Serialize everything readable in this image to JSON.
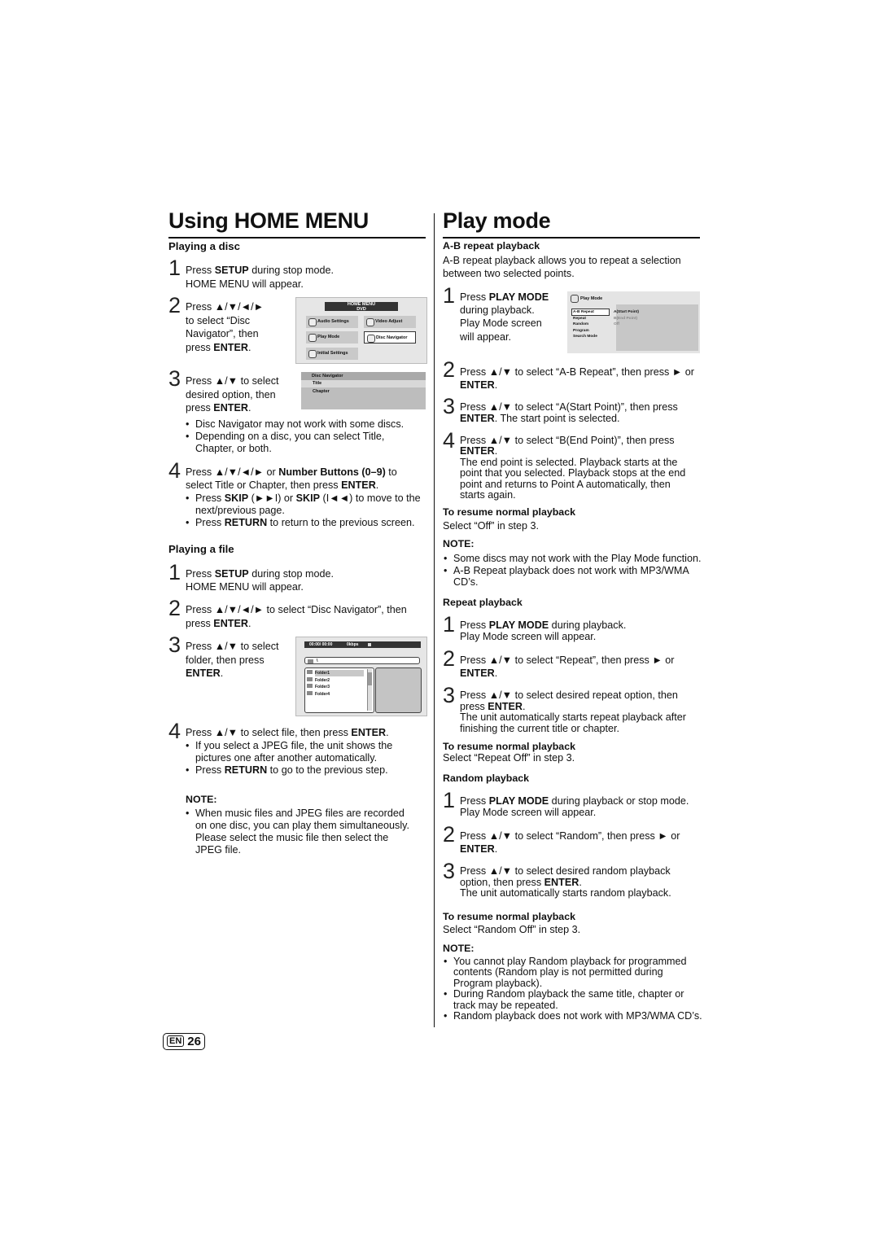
{
  "left": {
    "title": "Using HOME MENU",
    "disc": {
      "heading": "Playing a disc",
      "steps": [
        {
          "n": "1",
          "lines": [
            "Press **SETUP** during stop mode.",
            "HOME MENU will appear."
          ]
        },
        {
          "n": "2",
          "lines": [
            "Press ▲/▼/◄/►",
            "to select “Disc",
            "Navigator”, then",
            "press **ENTER**."
          ]
        },
        {
          "n": "3",
          "lines": [
            "Press ▲/▼ to select",
            "desired option, then",
            "press **ENTER**."
          ]
        },
        {
          "n": "4",
          "lines": [
            "Press ▲/▼/◄/► or **Number Buttons (0–9)** to",
            "select Title or Chapter, then press **ENTER**."
          ]
        }
      ],
      "bullets3": [
        [
          "Disc Navigator may not work with some discs."
        ],
        [
          "Depending on a disc, you can select Title,",
          "Chapter, or both."
        ]
      ],
      "bullets4": [
        [
          "Press **SKIP** (►►I) or **SKIP** (I◄◄) to move to the",
          "next/previous page."
        ],
        [
          "Press **RETURN** to return to the previous screen."
        ]
      ]
    },
    "file": {
      "heading": "Playing a file",
      "steps": [
        {
          "n": "1",
          "lines": [
            "Press **SETUP** during stop mode.",
            "HOME MENU will appear."
          ]
        },
        {
          "n": "2",
          "lines": [
            "Press ▲/▼/◄/► to select “Disc Navigator”, then",
            "press **ENTER**."
          ]
        },
        {
          "n": "3",
          "lines": [
            "Press ▲/▼ to select",
            "folder, then press",
            "**ENTER**."
          ]
        },
        {
          "n": "4",
          "lines": [
            "Press ▲/▼ to select file, then press **ENTER**."
          ]
        }
      ],
      "bullets4": [
        [
          "If you select a JPEG file, the unit shows the",
          "pictures one after another automatically."
        ],
        [
          "Press **RETURN** to go to the previous step."
        ]
      ],
      "note_label": "NOTE:",
      "note": [
        [
          "When music files and JPEG files are recorded",
          "on one disc, you can play them simultaneously.",
          "Please select the music file then select the",
          "JPEG file."
        ]
      ]
    }
  },
  "screens": {
    "home": {
      "title": "HOME MENU",
      "sub": "DVD",
      "tiles": [
        "Audio Settings",
        "Video Adjust",
        "Play Mode",
        "Disc Navigator",
        "Initial Settings"
      ]
    },
    "nav": {
      "title": "Disc Navigator",
      "items": [
        "Title",
        "Chapter"
      ]
    },
    "file": {
      "time": "00:00/ 00:00",
      "rate": "0kbps",
      "path": "\\",
      "folders": [
        "Folder1",
        "Folder2",
        "Folder3",
        "Folder4"
      ]
    },
    "play": {
      "title": "Play Mode",
      "items": [
        "A-B Repeat",
        "Repeat",
        "Random",
        "Program",
        "Search Mode"
      ],
      "options": [
        "A(Start Point)",
        "B(End Point)",
        "Off"
      ]
    }
  },
  "right": {
    "title": "Play mode",
    "ab": {
      "heading": "A-B repeat playback",
      "intro": [
        "A-B repeat playback allows you to repeat a selection",
        "between two selected points."
      ],
      "steps": [
        {
          "n": "1",
          "lines": [
            "Press **PLAY MODE**",
            "during playback.",
            "Play Mode screen",
            "will appear."
          ]
        },
        {
          "n": "2",
          "lines": [
            "Press ▲/▼ to select “A-B Repeat”, then press ► or",
            "**ENTER**."
          ]
        },
        {
          "n": "3",
          "lines": [
            "Press ▲/▼ to select “A(Start Point)”, then press",
            "**ENTER**. The start point is selected."
          ]
        },
        {
          "n": "4",
          "lines": [
            "Press ▲/▼ to select “B(End Point)”, then press",
            "**ENTER**.",
            "The end point is selected. Playback starts at the",
            "point that you selected. Playback stops at the end",
            "point and returns to Point A automatically, then",
            "starts again."
          ]
        }
      ],
      "resume_heading": "To resume normal playback",
      "resume": "Select “Off” in step 3.",
      "note_label": "NOTE:",
      "note": [
        [
          "Some discs may not work with the Play Mode function."
        ],
        [
          "A-B Repeat playback does not work with MP3/WMA",
          "CD’s."
        ]
      ]
    },
    "repeat": {
      "heading": "Repeat playback",
      "steps": [
        {
          "n": "1",
          "lines": [
            "Press **PLAY MODE** during playback.",
            "Play Mode screen will appear."
          ]
        },
        {
          "n": "2",
          "lines": [
            "Press ▲/▼ to select “Repeat”, then press ► or",
            "**ENTER**."
          ]
        },
        {
          "n": "3",
          "lines": [
            "Press ▲/▼ to select desired repeat option, then",
            "press **ENTER**.",
            "The unit automatically starts repeat playback after",
            "finishing the current title or chapter."
          ]
        }
      ],
      "resume_heading": "To resume normal playback",
      "resume": "Select “Repeat Off” in step 3."
    },
    "random": {
      "heading": "Random playback",
      "steps": [
        {
          "n": "1",
          "lines": [
            "Press **PLAY MODE** during playback or stop mode.",
            "Play Mode screen will appear."
          ]
        },
        {
          "n": "2",
          "lines": [
            "Press ▲/▼ to select “Random”, then press ► or",
            "**ENTER**."
          ]
        },
        {
          "n": "3",
          "lines": [
            "Press ▲/▼ to select desired random playback",
            "option, then press **ENTER**.",
            "The unit automatically starts random playback."
          ]
        }
      ],
      "resume_heading": "To resume normal playback",
      "resume": "Select “Random Off” in step 3.",
      "note_label": "NOTE:",
      "note": [
        [
          "You cannot play Random playback for programmed",
          "contents (Random play is not permitted during",
          "Program playback)."
        ],
        [
          "During Random playback the same title, chapter or",
          "track may be repeated."
        ],
        [
          "Random playback does not work with MP3/WMA CD’s."
        ]
      ]
    }
  },
  "footer": {
    "lang": "EN",
    "page": "26"
  }
}
